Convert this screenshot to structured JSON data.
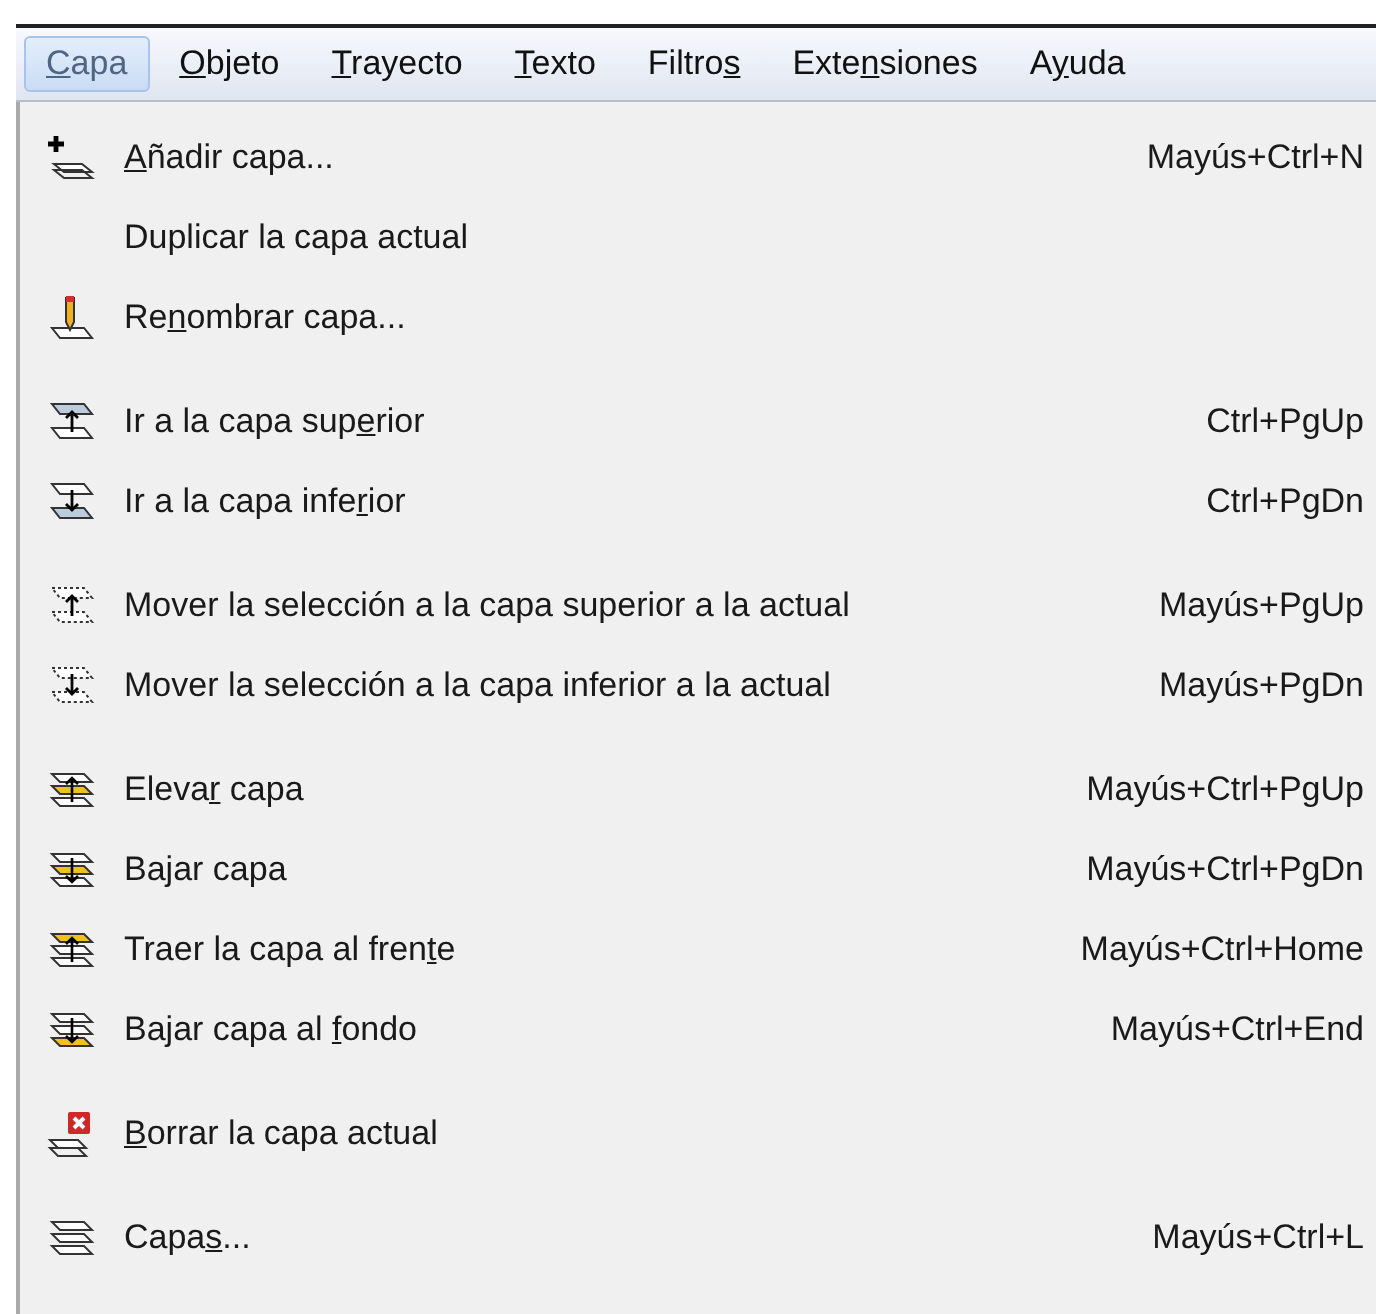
{
  "menu_bar": [
    {
      "key": "C",
      "post": "apa",
      "selected": true
    },
    {
      "key": "O",
      "post": "bjeto",
      "selected": false
    },
    {
      "key": "T",
      "post": "rayecto",
      "selected": false
    },
    {
      "key": "T",
      "post": "exto",
      "selected": false
    },
    {
      "pre": "Filtro",
      "key": "s",
      "selected": false
    },
    {
      "pre": "Exte",
      "key": "n",
      "post": "siones",
      "selected": false
    },
    {
      "pre": "A",
      "key": "y",
      "post": "uda",
      "selected": false
    }
  ],
  "menu": {
    "groups": [
      {
        "items": [
          {
            "kind": "add",
            "key": "A",
            "post": "ñadir capa...",
            "shortcut": "Mayús+Ctrl+N"
          },
          {
            "kind": "plain",
            "pre": "Duplicar la capa actual"
          },
          {
            "kind": "rename",
            "pre": "Re",
            "key": "n",
            "post": "ombrar capa..."
          }
        ]
      },
      {
        "items": [
          {
            "kind": "goup",
            "pre": "Ir a la capa sup",
            "key": "e",
            "post": "rior",
            "shortcut": "Ctrl+PgUp"
          },
          {
            "kind": "godown",
            "pre": "Ir a la capa infe",
            "key": "r",
            "post": "ior",
            "shortcut": "Ctrl+PgDn"
          }
        ]
      },
      {
        "items": [
          {
            "kind": "moveup",
            "pre": "Mover la selección a la capa superior a la actual",
            "shortcut": "Mayús+PgUp"
          },
          {
            "kind": "movedown",
            "pre": "Mover la selección a la capa inferior a la actual",
            "shortcut": "Mayús+PgDn"
          }
        ]
      },
      {
        "items": [
          {
            "kind": "raise",
            "pre": "Eleva",
            "key": "r",
            "post": " capa",
            "shortcut": "Mayús+Ctrl+PgUp"
          },
          {
            "kind": "lower",
            "pre": "Ba",
            "key": "j",
            "post": "ar capa",
            "shortcut": "Mayús+Ctrl+PgDn"
          },
          {
            "kind": "top",
            "pre": "Traer la capa al fren",
            "key": "t",
            "post": "e",
            "shortcut": "Mayús+Ctrl+Home"
          },
          {
            "kind": "bottom",
            "pre": "Bajar capa al ",
            "key": "f",
            "post": "ondo",
            "shortcut": "Mayús+Ctrl+End"
          }
        ]
      },
      {
        "items": [
          {
            "kind": "delete",
            "key": "B",
            "post": "orrar la capa actual"
          }
        ]
      },
      {
        "items": [
          {
            "kind": "layers",
            "pre": "Capa",
            "key": "s",
            "post": "...",
            "shortcut": "Mayús+Ctrl+L"
          }
        ]
      }
    ]
  }
}
